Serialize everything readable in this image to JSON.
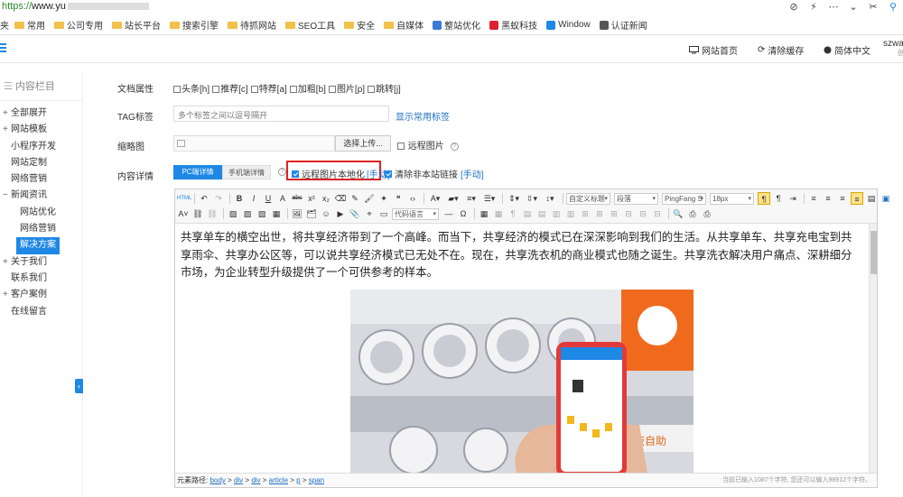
{
  "browser": {
    "url_scheme": "https://",
    "url_host": "www.yu"
  },
  "bookmarks": [
    {
      "label": "常用",
      "type": "folder"
    },
    {
      "label": "公司专用",
      "type": "folder"
    },
    {
      "label": "站长平台",
      "type": "folder"
    },
    {
      "label": "搜索引擎",
      "type": "folder"
    },
    {
      "label": "待抓网站",
      "type": "folder"
    },
    {
      "label": "SEO工具",
      "type": "folder"
    },
    {
      "label": "安全",
      "type": "folder"
    },
    {
      "label": "自媒体",
      "type": "folder"
    },
    {
      "label": "整站优化",
      "type": "site",
      "color": "#3a7bd5"
    },
    {
      "label": "黑蚁科技",
      "type": "site",
      "color": "#d23"
    },
    {
      "label": "Window",
      "type": "site",
      "color": "#1e88e5"
    },
    {
      "label": "认证新闻",
      "type": "site",
      "color": "#555"
    }
  ],
  "bookmark_prefix": "夹",
  "header": {
    "links": [
      {
        "label": "网站首页",
        "icon": "monitor-icon"
      },
      {
        "label": "清除缓存",
        "icon": "refresh-icon"
      },
      {
        "label": "简体中文",
        "icon": "globe-icon"
      }
    ],
    "user": "szwar",
    "user_sub": "创"
  },
  "sidebar": {
    "title": "内容栏目",
    "items": [
      {
        "label": "全部展开",
        "toggle": "+",
        "sub": false
      },
      {
        "label": "网站模板",
        "toggle": "+",
        "sub": false
      },
      {
        "label": "小程序开发",
        "toggle": "",
        "sub": false
      },
      {
        "label": "网站定制",
        "toggle": "",
        "sub": false
      },
      {
        "label": "网络营销",
        "toggle": "",
        "sub": false
      },
      {
        "label": "新闻资讯",
        "toggle": "−",
        "sub": false
      },
      {
        "label": "网站优化",
        "toggle": "",
        "sub": true
      },
      {
        "label": "网络营销",
        "toggle": "",
        "sub": true
      },
      {
        "label": "解决方案",
        "toggle": "",
        "sub": true,
        "active": true
      },
      {
        "label": "关于我们",
        "toggle": "+",
        "sub": false
      },
      {
        "label": "联系我们",
        "toggle": "",
        "sub": false
      },
      {
        "label": "客户案例",
        "toggle": "+",
        "sub": false
      },
      {
        "label": "在线留言",
        "toggle": "",
        "sub": false
      }
    ]
  },
  "form": {
    "attr_label": "文档属性",
    "attrs": [
      "头条[h]",
      "推荐[c]",
      "特荐[a]",
      "加粗[b]",
      "图片[p]",
      "跳转[j]"
    ],
    "tag_label": "TAG标签",
    "tag_placeholder": "多个标签之间以逗号隔开",
    "tag_link": "显示常用标签",
    "thumb_label": "缩略图",
    "upload_button": "选择上传...",
    "remote_thumb": "远程图片",
    "content_label": "内容详情",
    "tab_pc": "PC端详情",
    "tab_mobile": "手机端详情",
    "opt_localize": "远程图片本地化",
    "opt_localize_link": "[手动]",
    "opt_strip_links": "清除非本站链接",
    "opt_strip_link": "[手动]"
  },
  "editor": {
    "toolbar": {
      "custom_title": "自定义标题",
      "paragraph": "段落",
      "font_family": "PingFang S",
      "font_size": "18px",
      "code_lang": "代码语言"
    },
    "paragraph": "共享单车的横空出世，将共享经济带到了一个高峰。而当下，共享经济的模式已在深深影响到我们的生活。从共享单车、共享充电宝到共享雨伞、共享办公区等，可以说共享经济模式已无处不在。现在，共享洗衣机的商业模式也随之诞生。共享洗衣解决用户痛点、深耕细分市场，为企业转型升级提供了一个可供参考的样本。",
    "path_label": "元素路径:",
    "path": [
      "body",
      "div",
      "div",
      "article",
      "p",
      "span"
    ],
    "count_text": "当前已输入1087个字符, 您还可以输入98912个字符。"
  }
}
